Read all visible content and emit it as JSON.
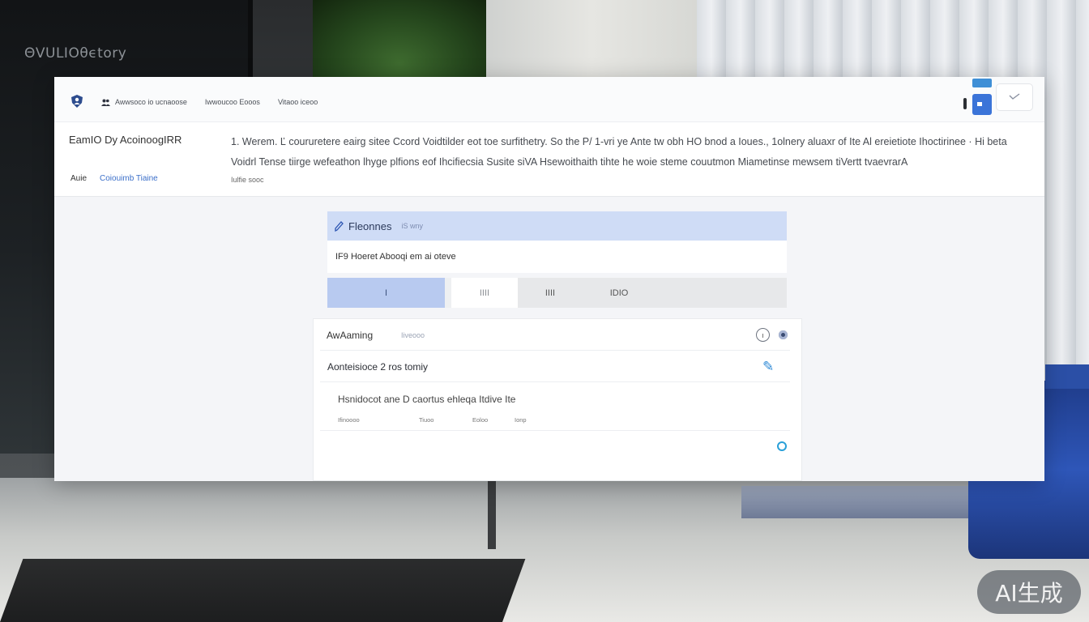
{
  "background": {
    "wall_label": "ΘVULΙΟθϵtory"
  },
  "topbar": {
    "logo_icon": "shield-person-icon",
    "nav": [
      {
        "label": "Awwsoco io ucnaoose",
        "icon": "people-icon"
      },
      {
        "label": "Iwwoucoo Eooos"
      },
      {
        "label": "Vitaoo iceoo"
      }
    ],
    "user_icon": "chevron-icon"
  },
  "info": {
    "title": "EamΙΟ Dy AcoinoogIRR",
    "sub_a": "Auie",
    "sub_b": "Coiouimb Tiaine",
    "description": "1. Werem. Ľ coururetere eairg sitee Ccord Voidtilder eot toe surfithetry. So the P/ 1-vri ye Ante tw obh HO bnod a Ioues., 1olnery aluaxr of Ite Al ereietiote Ihoctirinee · Hi beta Voidrl Tense tiirge wefeathon lhyge plfions eof Ihcifiecsia Susite siVA Hsewoithaith tihte he woie steme couutmon Miametinse mewsem tiVertt tvaevrarA",
    "footer": "Iulfie sooc"
  },
  "search_panel": {
    "title": "Fleonnes",
    "subtitle": "iS wny",
    "input_value": "IF9 Hoeret Abooqi em ai oteve",
    "tabs": [
      {
        "label": "Ι"
      },
      {
        "label": "ΙΙΙΙ"
      },
      {
        "label": "ΙΙΙΙ"
      },
      {
        "label": "IDIO"
      }
    ]
  },
  "list_panel": {
    "row1_title": "AwAaming",
    "row1_sub": "Iiveooo",
    "row1_clock": "ı",
    "row2_title": "Aonteisioce 2 ros tomiy",
    "row3_title": "Hsnidocot ane D caortus ehleqa Itdive Ite",
    "row3_cols": [
      "Ifinoooo",
      "Tiuoo",
      "Eoloo",
      "Ionp"
    ]
  },
  "watermark": "AI生成",
  "colors": {
    "accent": "#3b74d8",
    "panel_header": "#cfdcf6",
    "active_tab": "#b8caf0",
    "ring": "#2aa0d8"
  }
}
